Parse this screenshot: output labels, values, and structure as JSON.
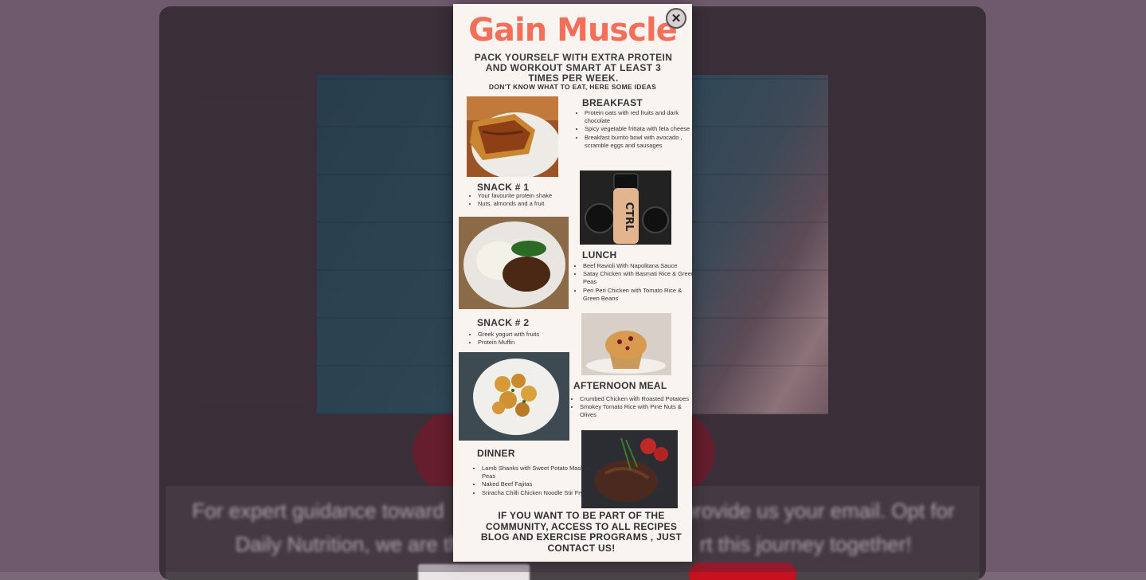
{
  "background": {
    "title": "",
    "text_line1": "For expert guidance toward",
    "text_line1b": "provide us your email. Opt for",
    "text_line2": "Daily Nutrition, we are th",
    "text_line2b": "rt this journey together!"
  },
  "modal": {
    "close_label": "✕",
    "title": "Gain Muscle",
    "subtitle": "PACK YOURSELF WITH EXTRA PROTEIN AND WORKOUT SMART AT LEAST 3 TIMES PER WEEK.",
    "subtitle2": "DON'T KNOW WHAT TO EAT, HERE SOME IDEAS",
    "breakfast": {
      "heading": "BREAKFAST",
      "items": [
        "Protein oats with red fruits and dark chocolate",
        "Spicy vegetable frittata with feta cheese",
        "Breakfast burrito bowl with avocado , scramble eggs and sausages"
      ]
    },
    "snack1": {
      "heading": "SNACK # 1",
      "items": [
        "Your favourite protein shake",
        "Nuts, almonds and a fruit"
      ]
    },
    "lunch": {
      "heading": "LUNCH",
      "items": [
        "Beef Ravioli With Napolitana Sauce",
        "Satay Chicken with Basmati Rice & Green Peas",
        "Peri Peri Chicken with Tomato Rice & Green Beans"
      ]
    },
    "snack2": {
      "heading": "SNACK # 2",
      "items": [
        "Greek yogurt with fruits",
        "Protein Muffin"
      ]
    },
    "afternoon": {
      "heading": "AFTERNOON MEAL",
      "items": [
        "Crumbed Chicken with Roasted Potatoes",
        "Smokey Tomato Rice with Pine Nuts & Olives"
      ]
    },
    "dinner": {
      "heading": "DINNER",
      "items": [
        "Lamb Shanks with Sweet Potato Mash & Peas",
        "Naked Beef Fajitas",
        "Sriracha Chilli Chicken Noodle Stir Fry"
      ]
    },
    "shaker_text": "CTRL",
    "footer": "IF YOU WANT TO BE PART OF THE COMMUNITY, ACCESS TO ALL RECIPES BLOG AND EXERCISE PROGRAMS , JUST CONTACT US!"
  },
  "colors": {
    "title": "#f36f5a",
    "modal_bg": "#f9f4f0",
    "text": "#333333"
  }
}
